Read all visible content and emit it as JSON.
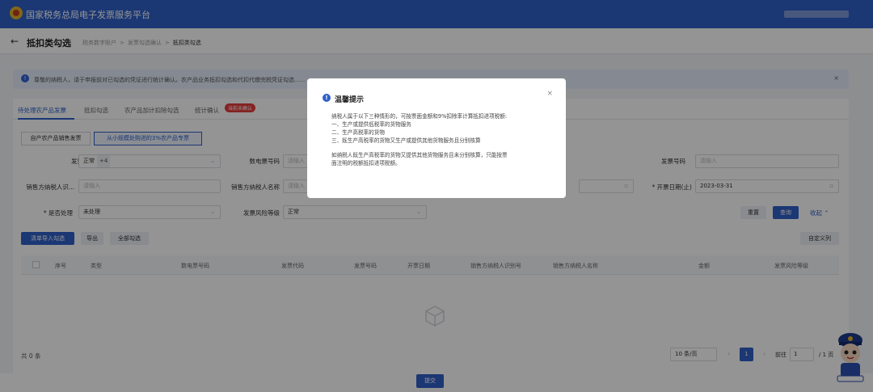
{
  "header": {
    "app_title": "国家税务总局电子发票服务平台"
  },
  "page": {
    "title": "抵扣类勾选",
    "breadcrumbs": [
      "税务数字账户",
      ">",
      "发票勾选确认",
      ">",
      "抵扣类勾选"
    ]
  },
  "notice": {
    "text": "尊敬的纳税人，请于申报前对已勾选的凭证进行统计确认。农产品业务抵扣勾选和代扣代缴完税凭证勾选……"
  },
  "tabs": [
    {
      "label": "待处理农产品发票"
    },
    {
      "label": "抵扣勾选"
    },
    {
      "label": "农产品加计扣除勾选"
    },
    {
      "label": "统计确认"
    }
  ],
  "tab_badge": "当前未确认",
  "segments": [
    "自产农产品销售发票",
    "从小规模处购进的3%农产品专票"
  ],
  "filters": {
    "invoice_status_label": "发票状态",
    "invoice_status_value": "正常",
    "invoice_status_more": "+4",
    "digital_no_label": "数电票号码",
    "digital_no_placeholder": "请输入",
    "invoice_no_label": "发票号码",
    "invoice_no_placeholder": "请输入",
    "seller_tax_id_label": "销售方纳税人识...",
    "seller_tax_id_placeholder": "请输入",
    "seller_name_label": "销售方纳税人名称",
    "seller_name_placeholder": "请输入",
    "issue_date_end_label": "* 开票日期(止)",
    "issue_date_end_value": "2023-03-31",
    "processed_label": "* 是否处理",
    "processed_value": "未处理",
    "risk_label": "发票风险等级",
    "risk_value": "正常"
  },
  "actions": {
    "reset": "重置",
    "query": "查询",
    "collapse": "收起",
    "import": "清单导入勾选",
    "export": "导出",
    "select_all": "全部勾选",
    "custom_columns": "自定义列"
  },
  "table": {
    "columns": [
      "序号",
      "类型",
      "数电票号码",
      "发票代码",
      "发票号码",
      "开票日期",
      "销售方纳税人识别号",
      "销售方纳税人名称",
      "金额",
      "发票风险等级"
    ]
  },
  "pagination": {
    "total": "共 0 条",
    "page_size": "10 条/页",
    "current": "1",
    "goto_label": "前往",
    "goto_value": "1",
    "pages": "/ 1 页"
  },
  "footer": {
    "submit": "提交"
  },
  "modal": {
    "title": "温馨提示",
    "close": "×",
    "lines": [
      "纳税人属于以下三种情形的，可按票面金额和9%扣除率计算抵扣进项税额:",
      "一、生产或提供低税率的货物服务",
      "二、生产高税率的货物",
      "三、既生产高税率的货物又生产或提供其他货物服务且分别核算"
    ],
    "lines2": [
      "如纳税人既生产高税率的货物又提供其他货物服务且未分别核算，只能按票",
      "面注明的税额抵扣进项税额。"
    ]
  },
  "colors": {
    "primary": "#2f5fc9",
    "badge": "#e63b3b"
  }
}
